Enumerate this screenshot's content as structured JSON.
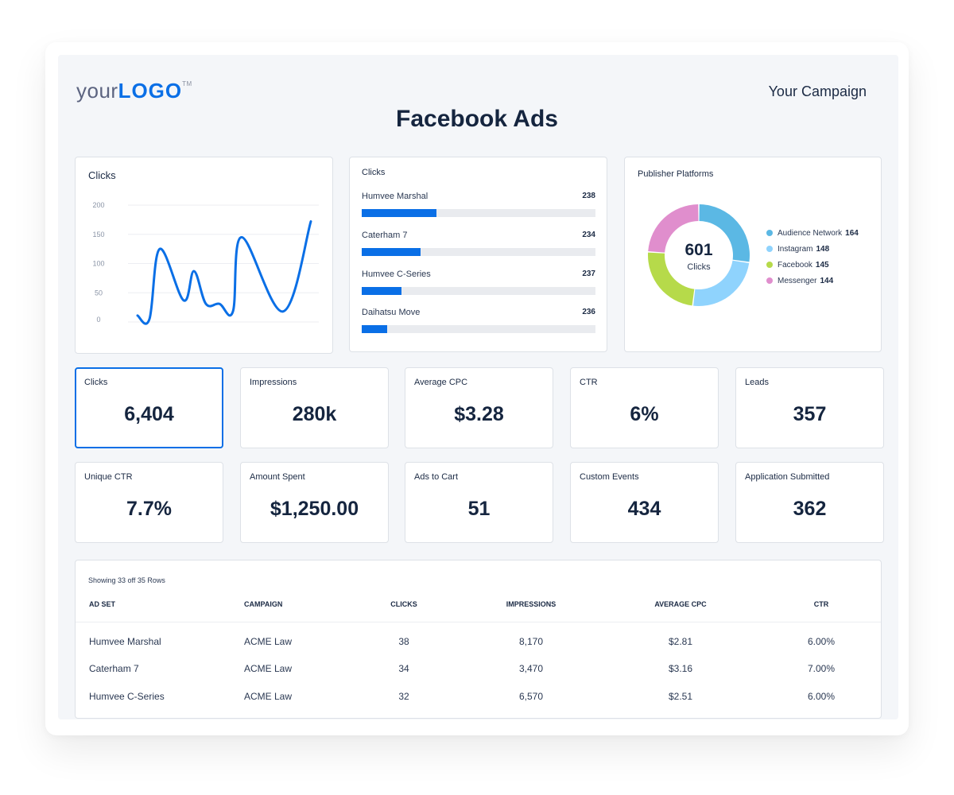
{
  "header": {
    "logo_prefix": "your",
    "logo_brand": "LOGO",
    "logo_tm": "TM",
    "campaign": "Your Campaign",
    "title": "Facebook Ads"
  },
  "colors": {
    "accent": "#0a6fe6",
    "text_dark": "#15253f",
    "bar_track": "#e9ebef"
  },
  "chart_data": [
    {
      "type": "line",
      "title": "Clicks",
      "xlabel": "",
      "ylabel": "",
      "ylim": [
        0,
        200
      ],
      "yticks": [
        "0",
        "50",
        "100",
        "150",
        "200"
      ],
      "grid": true,
      "x": [
        1,
        2,
        3,
        4,
        5,
        6,
        7,
        8,
        9,
        10,
        11
      ],
      "values": [
        11,
        5,
        125,
        37,
        87,
        31,
        31,
        18,
        145,
        18,
        172
      ],
      "color": "#0a6fe6"
    },
    {
      "type": "bar",
      "orientation": "horizontal",
      "title": "Clicks",
      "categories": [
        "Humvee Marshal",
        "Caterham 7",
        "Humvee C-Series",
        "Daihatsu Move"
      ],
      "values": [
        238,
        234,
        237,
        236
      ],
      "value_labels": [
        "238",
        "234",
        "237",
        "236"
      ],
      "fill_fraction": [
        0.32,
        0.25,
        0.17,
        0.11
      ],
      "color": "#0a6fe6"
    },
    {
      "type": "pie",
      "donut": true,
      "title": "Publisher Platforms",
      "center_value": "601",
      "center_label": "Clicks",
      "categories": [
        "Audience Network",
        "Instagram",
        "Facebook",
        "Messenger"
      ],
      "values": [
        164,
        148,
        145,
        144
      ],
      "colors": [
        "#5bb8e4",
        "#8fd3fd",
        "#b6da4a",
        "#e08ecd"
      ],
      "legend_position": "right"
    }
  ],
  "kpis": [
    {
      "label": "Clicks",
      "value": "6,404",
      "active": true
    },
    {
      "label": "Impressions",
      "value": "280k"
    },
    {
      "label": "Average CPC",
      "value": "$3.28"
    },
    {
      "label": "CTR",
      "value": "6%"
    },
    {
      "label": "Leads",
      "value": "357"
    },
    {
      "label": "Unique CTR",
      "value": "7.7%"
    },
    {
      "label": "Amount Spent",
      "value": "$1,250.00"
    },
    {
      "label": "Ads to Cart",
      "value": "51"
    },
    {
      "label": "Custom Events",
      "value": "434"
    },
    {
      "label": "Application Submitted",
      "value": "362"
    }
  ],
  "table": {
    "caption": "Showing 33 off 35 Rows",
    "columns": [
      "AD SET",
      "CAMPAIGN",
      "CLICKS",
      "IMPRESSIONS",
      "AVERAGE CPC",
      "CTR"
    ],
    "rows": [
      [
        "Humvee Marshal",
        "ACME Law",
        "38",
        "8,170",
        "$2.81",
        "6.00%"
      ],
      [
        "Caterham 7",
        "ACME Law",
        "34",
        "3,470",
        "$3.16",
        "7.00%"
      ],
      [
        "Humvee C-Series",
        "ACME Law",
        "32",
        "6,570",
        "$2.51",
        "6.00%"
      ]
    ]
  }
}
